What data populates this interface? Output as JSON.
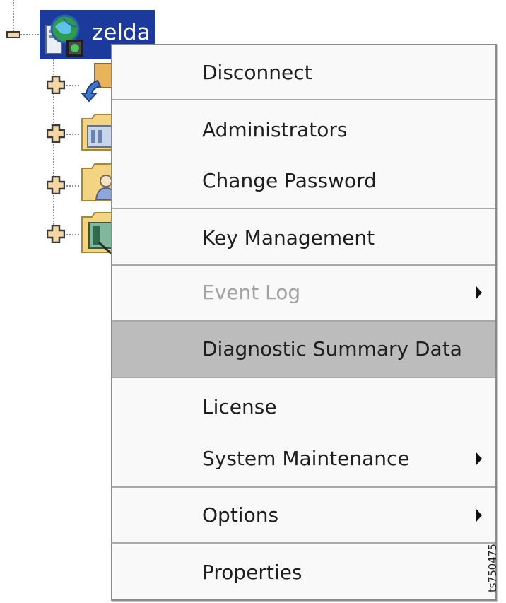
{
  "tree": {
    "root": {
      "label": "zelda",
      "state": "expanded",
      "selected": true,
      "icon": "server-globe-icon"
    },
    "children": [
      {
        "state": "collapsed",
        "icon": "arrow-agent-icon"
      },
      {
        "state": "collapsed",
        "icon": "folder-server-icon"
      },
      {
        "state": "collapsed",
        "icon": "folder-user-icon"
      },
      {
        "state": "collapsed",
        "icon": "folder-device-icon"
      }
    ]
  },
  "context_menu": {
    "highlighted_index": 5,
    "items": [
      {
        "label": "Disconnect",
        "enabled": true,
        "submenu": false
      },
      {
        "label": "Administrators",
        "enabled": true,
        "submenu": false
      },
      {
        "label": "Change Password",
        "enabled": true,
        "submenu": false
      },
      {
        "label": "Key Management",
        "enabled": true,
        "submenu": false
      },
      {
        "label": "Event Log",
        "enabled": false,
        "submenu": true
      },
      {
        "label": "Diagnostic Summary Data",
        "enabled": true,
        "submenu": false
      },
      {
        "label": "License",
        "enabled": true,
        "submenu": false
      },
      {
        "label": "System Maintenance",
        "enabled": true,
        "submenu": true
      },
      {
        "label": "Options",
        "enabled": true,
        "submenu": true
      },
      {
        "label": "Properties",
        "enabled": true,
        "submenu": false
      }
    ]
  },
  "figure_id": "ts750475",
  "colors": {
    "selection": "#1c3a9c",
    "menu_highlight": "#bcbcbc",
    "disabled_text": "#a3a3a3",
    "menu_background": "#f9f9f9"
  }
}
